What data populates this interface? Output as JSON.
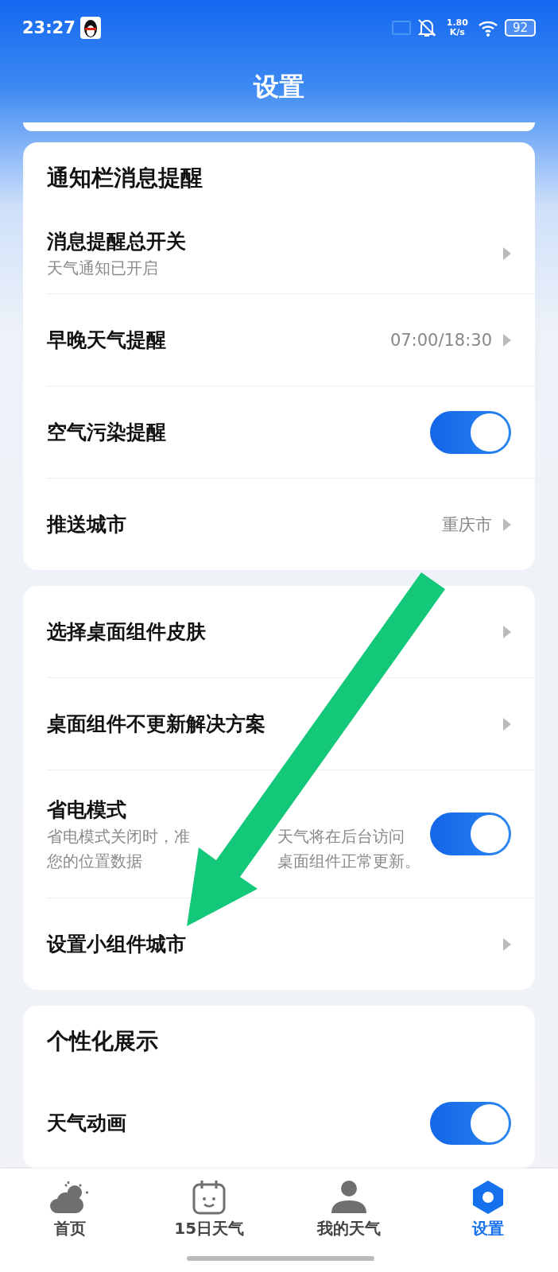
{
  "status_bar": {
    "time": "23:27",
    "speed_value": "1.80",
    "speed_unit": "K/s",
    "battery": "92"
  },
  "title": "设置",
  "sections": [
    {
      "heading": "通知栏消息提醒",
      "rows": [
        {
          "kind": "link",
          "label": "消息提醒总开关",
          "subtitle": [
            "天气通知已开启"
          ]
        },
        {
          "kind": "link",
          "label": "早晚天气提醒",
          "value": "07:00/18:30"
        },
        {
          "kind": "toggle",
          "label": "空气污染提醒",
          "on": true
        },
        {
          "kind": "link",
          "label": "推送城市",
          "value": "重庆市"
        }
      ]
    },
    {
      "rows": [
        {
          "kind": "link",
          "label": "选择桌面组件皮肤"
        },
        {
          "kind": "link",
          "label": "桌面组件不更新解决方案"
        },
        {
          "kind": "toggle",
          "label": "省电模式",
          "on": true,
          "description": [
            [
              "省电模式关闭时，准",
              "天气将在后台访问"
            ],
            [
              "您的位置数据",
              "桌面组件正常更新。"
            ]
          ]
        },
        {
          "kind": "link",
          "label": "设置小组件城市"
        }
      ]
    },
    {
      "heading": "个性化展示",
      "rows": [
        {
          "kind": "toggle",
          "label": "天气动画",
          "on": true
        }
      ]
    }
  ],
  "tabs": [
    {
      "kind": "home",
      "label": "首页",
      "selected": false
    },
    {
      "kind": "calendar",
      "label": "15日天气",
      "selected": false
    },
    {
      "kind": "person",
      "label": "我的天气",
      "selected": false
    },
    {
      "kind": "settings",
      "label": "设置",
      "selected": true
    }
  ]
}
